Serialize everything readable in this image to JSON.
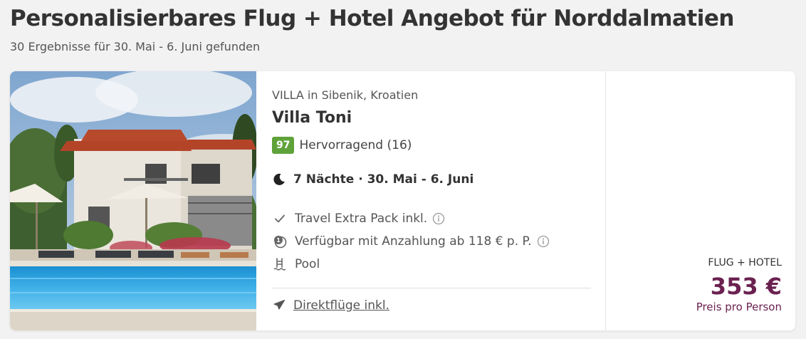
{
  "page": {
    "title": "Personalisierbares Flug + Hotel Angebot für Norddalmatien",
    "subtitle": "30 Ergebnisse für 30. Mai - 6. Juni gefunden"
  },
  "offer": {
    "category": "VILLA in Sibenik, Kroatien",
    "name": "Villa Toni",
    "rating": {
      "score": "97",
      "label": "Hervorragend (16)",
      "badge_color": "#5fa23a"
    },
    "stay": "7 Nächte · 30. Mai - 6. Juni",
    "features": [
      {
        "icon": "check-icon",
        "label": "Travel Extra Pack inkl."
      },
      {
        "icon": "deposit-icon",
        "label": "Verfügbar mit Anzahlung ab 118 € p. P."
      },
      {
        "icon": "pool-icon",
        "label": "Pool"
      }
    ],
    "flight_link": "Direktflüge inkl.",
    "price": {
      "label": "FLUG + HOTEL",
      "value": "353 €",
      "note": "Preis pro Person",
      "color": "#6b2150"
    }
  }
}
